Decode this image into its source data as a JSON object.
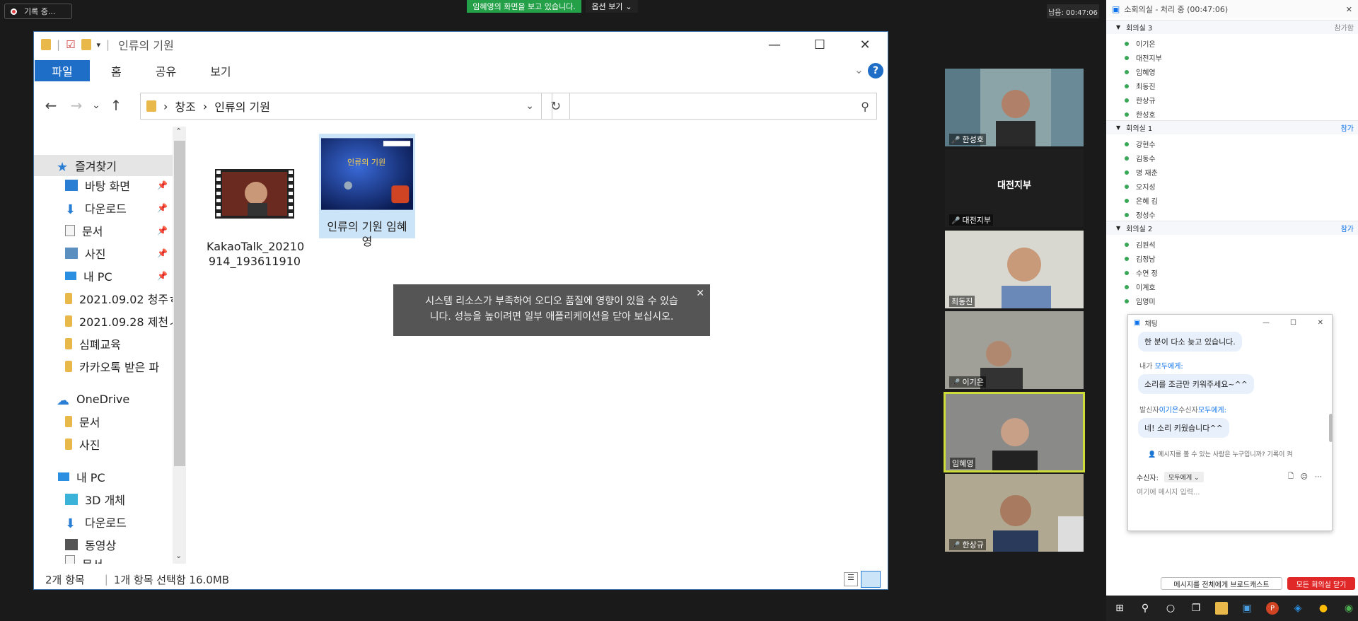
{
  "zoom": {
    "recording": "기록 중...",
    "share_banner": "임혜영의 화면을 보고 있습니다.",
    "view_options": "옵션 보기",
    "elapsed": "남음: 00:47:06"
  },
  "explorer": {
    "title": "인류의 기원",
    "ribbon_tabs": [
      "파일",
      "홈",
      "공유",
      "보기"
    ],
    "breadcrumb": [
      "창조",
      "인류의 기원"
    ],
    "sidebar": [
      {
        "label": "즐겨찾기",
        "icon": "star-icon"
      },
      {
        "label": "바탕 화면",
        "icon": "desktop-icon"
      },
      {
        "label": "다운로드",
        "icon": "download-icon"
      },
      {
        "label": "문서",
        "icon": "document-icon"
      },
      {
        "label": "사진",
        "icon": "pictures-icon"
      },
      {
        "label": "내 PC",
        "icon": "pc-icon"
      },
      {
        "label": "2021.09.02 청주ㅎ",
        "icon": "folder-icon"
      },
      {
        "label": "2021.09.28 제천ㅅ",
        "icon": "folder-icon"
      },
      {
        "label": "심폐교육",
        "icon": "folder-icon"
      },
      {
        "label": "카카오톡 받은 파",
        "icon": "folder-icon"
      },
      {
        "label": "OneDrive",
        "icon": "cloud-icon"
      },
      {
        "label": "문서",
        "icon": "folder-icon"
      },
      {
        "label": "사진",
        "icon": "folder-icon"
      },
      {
        "label": "내 PC",
        "icon": "pc-icon"
      },
      {
        "label": "3D 개체",
        "icon": "3d-objects-icon"
      },
      {
        "label": "다운로드",
        "icon": "download-icon"
      },
      {
        "label": "동영상",
        "icon": "video-icon"
      },
      {
        "label": "문서",
        "icon": "document-icon"
      }
    ],
    "files": [
      {
        "name_line1": "KakaoTalk_20210",
        "name_line2": "914_193611910"
      },
      {
        "name_line1": "인류의 기원 임혜",
        "name_line2": "영",
        "thumb_text": "인류의 기원"
      }
    ],
    "status_count": "2개 항목",
    "status_selected": "1개 항목 선택함 16.0MB"
  },
  "notice": {
    "line1": "시스템 리소스가 부족하여 오디오 품질에 영향이 있을 수 있습",
    "line2": "니다. 성능을 높이려면 일부 애플리케이션을 닫아 보십시오."
  },
  "videos": [
    {
      "name": "한성호"
    },
    {
      "name": "대전지부",
      "center": "대전지부"
    },
    {
      "name": "최동진"
    },
    {
      "name": "이기은"
    },
    {
      "name": "임혜영"
    },
    {
      "name": "한상규"
    }
  ],
  "rooms": {
    "title": "소회의실 - 처리 중 (00:47:06)",
    "groups": [
      {
        "name": "회의실 3",
        "join": "참가함",
        "members": [
          "이기은",
          "대전지부",
          "임혜영",
          "최동진",
          "한상규",
          "한성호"
        ]
      },
      {
        "name": "회의실 1",
        "join": "참가",
        "members": [
          "강현수",
          "김동수",
          "명 재춘",
          "오지성",
          "은혜 김",
          "정성수"
        ]
      },
      {
        "name": "회의실 2",
        "join": "참가",
        "members": [
          "김원석",
          "김정남",
          "수연 정",
          "이계호",
          "임영미"
        ]
      }
    ],
    "broadcast": "메시지를 전체에게 브로드캐스트",
    "close_all": "모든 회의실 닫기"
  },
  "chat": {
    "title": "채팅",
    "messages": [
      {
        "text": "한 분이 다소 늦고 있습니다."
      },
      {
        "meta_prefix": "내가 ",
        "meta_target": "모두에게:",
        "text": "소리를 조금만 키워주세요~^^"
      },
      {
        "meta_prefix": "발신자",
        "meta_sender": "이기은",
        "meta_mid": "수신자",
        "meta_target": "모두에게:",
        "text": "네! 소리 키웠습니다^^"
      }
    ],
    "info": "메시지를 볼 수 있는 사람은 누구입니까? 기록이 켜",
    "recipient_label": "수신자:",
    "recipient_value": "모두에게",
    "input_placeholder": "여기에 메시지 입력..."
  }
}
